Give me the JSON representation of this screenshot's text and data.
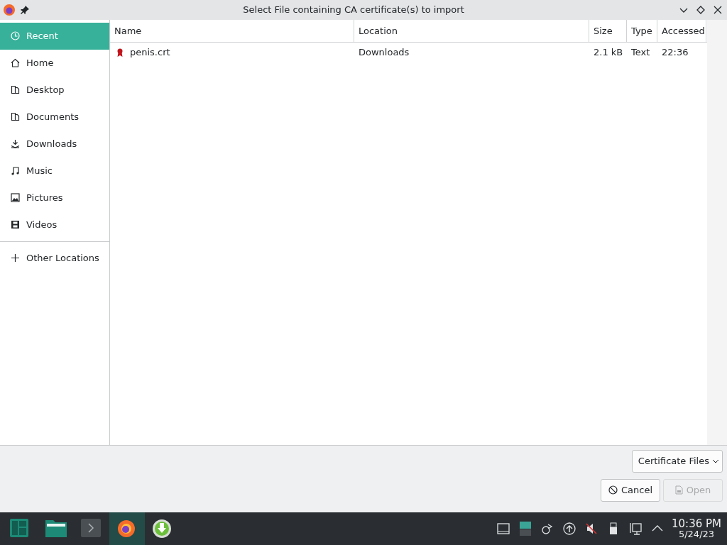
{
  "window": {
    "title": "Select File containing CA certificate(s) to import"
  },
  "sidebar": {
    "items": [
      {
        "label": "Recent",
        "selected": true
      },
      {
        "label": "Home",
        "selected": false
      },
      {
        "label": "Desktop",
        "selected": false
      },
      {
        "label": "Documents",
        "selected": false
      },
      {
        "label": "Downloads",
        "selected": false
      },
      {
        "label": "Music",
        "selected": false
      },
      {
        "label": "Pictures",
        "selected": false
      },
      {
        "label": "Videos",
        "selected": false
      }
    ],
    "other": {
      "label": "Other Locations",
      "selected": false
    }
  },
  "table": {
    "columns": [
      "Name",
      "Location",
      "Size",
      "Type",
      "Accessed"
    ],
    "rows": [
      {
        "name": "penis.crt",
        "location": "Downloads",
        "size": "2.1 kB",
        "type": "Text",
        "accessed": "22:36",
        "selected": false
      }
    ]
  },
  "filter": {
    "value": "Certificate Files"
  },
  "buttons": [
    {
      "label": "Cancel",
      "kind": "cancel",
      "disabled": false
    },
    {
      "label": "Open",
      "kind": "open",
      "disabled": true
    }
  ],
  "taskbar": {
    "apps": [
      {
        "kind": "menu",
        "active": false
      },
      {
        "kind": "files",
        "active": false
      },
      {
        "kind": "terminal",
        "active": false
      },
      {
        "kind": "browser",
        "active": true
      },
      {
        "kind": "updater",
        "active": false
      }
    ],
    "tray": [
      {
        "kind": "window"
      },
      {
        "kind": "desktops"
      },
      {
        "kind": "network"
      },
      {
        "kind": "updates"
      },
      {
        "kind": "volume"
      },
      {
        "kind": "usb"
      },
      {
        "kind": "lan"
      },
      {
        "kind": "expand"
      }
    ],
    "time": "10:36 PM",
    "date": "5/24/23"
  }
}
